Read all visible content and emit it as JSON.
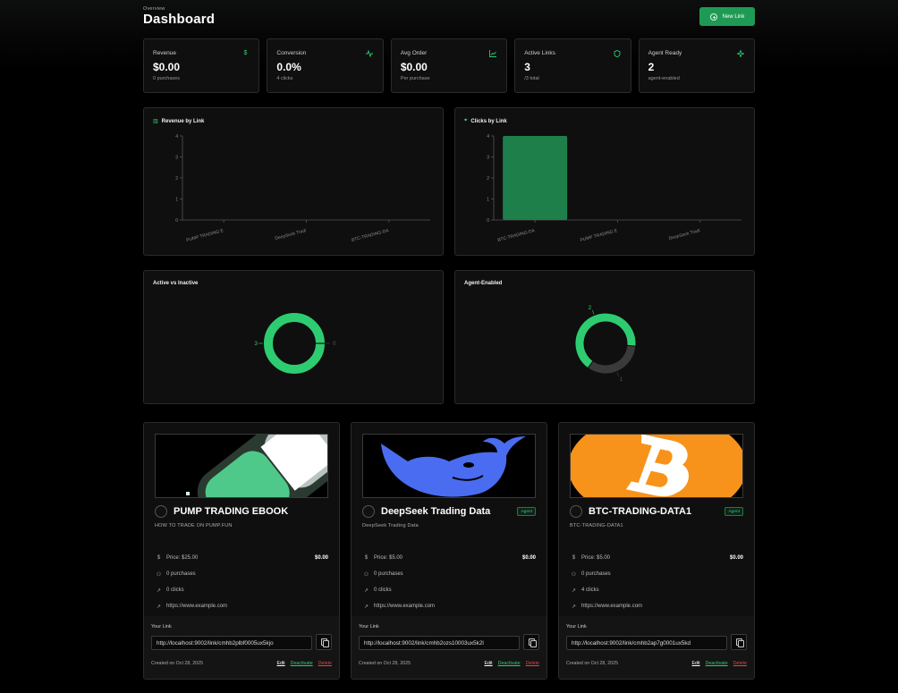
{
  "header": {
    "overline": "Overview",
    "title": "Dashboard",
    "new_link_label": "New Link"
  },
  "stats": [
    {
      "label": "Revenue",
      "value": "$0.00",
      "sub": "0 purchases",
      "icon": "dollar-icon"
    },
    {
      "label": "Conversion",
      "value": "0.0%",
      "sub": "4 clicks",
      "icon": "activity-icon"
    },
    {
      "label": "Avg Order",
      "value": "$0.00",
      "sub": "Per purchase",
      "icon": "chart-line-icon"
    },
    {
      "label": "Active Links",
      "value": "3",
      "sub": "/3 total",
      "icon": "shield-icon"
    },
    {
      "label": "Agent Ready",
      "value": "2",
      "sub": "agent-enabled",
      "icon": "sparkle-icon"
    }
  ],
  "colors": {
    "accent": "#2ecc71",
    "bar": "#1e7f4b",
    "muted": "#3a3a3a",
    "delete": "#e04545"
  },
  "chart_data": [
    {
      "type": "bar",
      "title": "Revenue by Link",
      "categories": [
        "PUMP TRADING E",
        "DeepSeek Tradi",
        "BTC-TRADING-DA"
      ],
      "values": [
        0,
        0,
        0
      ],
      "ylim": [
        0,
        4
      ],
      "yticks": [
        "0",
        "1",
        "2",
        "3",
        "4"
      ]
    },
    {
      "type": "bar",
      "title": "Clicks by Link",
      "categories": [
        "BTC-TRADING-DA",
        "PUMP TRADING E",
        "DeepSeek Tradi"
      ],
      "values": [
        4,
        0,
        0
      ],
      "ylim": [
        0,
        4
      ],
      "yticks": [
        "0",
        "1",
        "2",
        "3",
        "4"
      ]
    },
    {
      "type": "pie",
      "title": "Active vs Inactive",
      "labels": [
        "3",
        "0"
      ],
      "values": [
        3,
        0
      ]
    },
    {
      "type": "pie",
      "title": "Agent-Enabled",
      "labels": [
        "2",
        "1"
      ],
      "values": [
        2,
        1
      ]
    }
  ],
  "products": [
    {
      "name": "PUMP TRADING EBOOK",
      "desc": "HOW TO TRADE ON PUMP.FUN",
      "agent": "",
      "price": "Price: $25.00",
      "revenue": "$0.00",
      "purchases": "0 purchases",
      "clicks": "0 clicks",
      "url": "https://www.example.com",
      "your_link_label": "Your Link",
      "link": "http://localhost:9002/link/cmhb2plbf0005ux5kjo",
      "created": "Created on Oct 28, 2025",
      "edit": "Edit",
      "deactivate": "Deactivate",
      "delete": "Delete"
    },
    {
      "name": "DeepSeek Trading Data",
      "desc": "DeepSeek Trading Data",
      "agent": "Agent",
      "price": "Price: $5.00",
      "revenue": "$0.00",
      "purchases": "0 purchases",
      "clicks": "0 clicks",
      "url": "https://www.example.com",
      "your_link_label": "Your Link",
      "link": "http://localhost:9002/link/cmhb2ozs10003ux5k2l",
      "created": "Created on Oct 28, 2025",
      "edit": "Edit",
      "deactivate": "Deactivate",
      "delete": "Delete"
    },
    {
      "name": "BTC-TRADING-DATA1",
      "desc": "BTC-TRADING-DATA1",
      "agent": "Agent",
      "price": "Price: $5.00",
      "revenue": "$0.00",
      "purchases": "0 purchases",
      "clicks": "4 clicks",
      "url": "https://www.example.com",
      "your_link_label": "Your Link",
      "link": "http://localhost:9002/link/cmhb2ap7g0001ux5kd",
      "created": "Created on Oct 28, 2025",
      "edit": "Edit",
      "deactivate": "Deactivate",
      "delete": "Delete"
    }
  ]
}
